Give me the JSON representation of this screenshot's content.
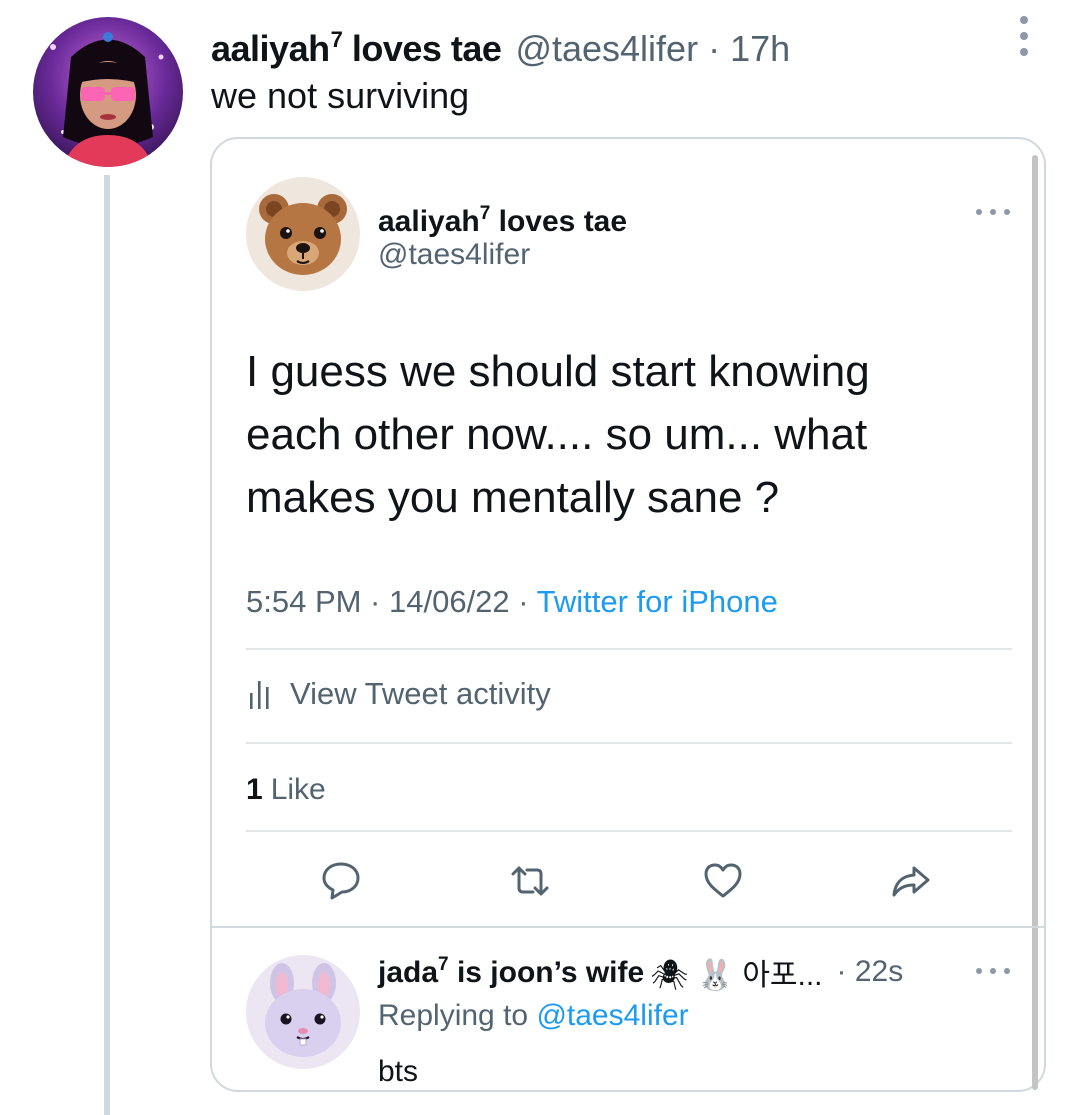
{
  "outer_tweet": {
    "display_name": "aaliyah",
    "name_sup": "7",
    "name_suffix": " loves tae",
    "handle": "@taes4lifer",
    "separator": "·",
    "time": "17h",
    "text": "we not surviving",
    "more_icon": "more-vertical-icon"
  },
  "quoted_tweet": {
    "display_name": "aaliyah",
    "name_sup": "7",
    "name_suffix": " loves tae",
    "handle": "@taes4lifer",
    "avatar_icon": "bear-face-emoji",
    "body_lines": [
      "I guess we should start knowing",
      "each other now.... so um... what",
      "makes you mentally sane ?"
    ],
    "timestamp": "5:54 PM · 14/06/22 · ",
    "source": "Twitter for iPhone",
    "activity_label": "View Tweet activity",
    "like_count": "1",
    "like_label": "Like",
    "actions": [
      "reply-icon",
      "retweet-icon",
      "like-icon",
      "share-icon"
    ]
  },
  "reply": {
    "display_name": "jada",
    "name_sup": "7",
    "name_suffix": " is joon’s wife",
    "emojis": "🕷 🐰 아포...",
    "time": "· 22s",
    "replying_prefix": "Replying to ",
    "replying_handle": "@taes4lifer",
    "text": "bts",
    "avatar_icon": "rabbit-face-emoji"
  },
  "colors": {
    "primary_text": "#0f1419",
    "secondary_text": "#536471",
    "link": "#1d9bf0",
    "border": "#cfd9de"
  }
}
